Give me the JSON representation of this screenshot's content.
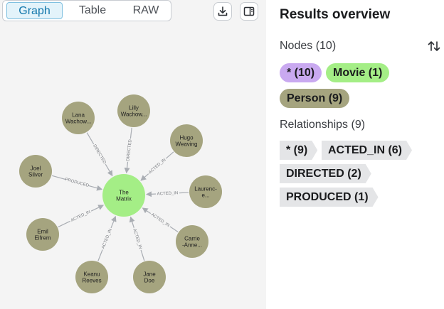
{
  "tabs": [
    {
      "label": "Graph",
      "active": true
    },
    {
      "label": "Table",
      "active": false
    },
    {
      "label": "RAW",
      "active": false
    }
  ],
  "toolbar": {
    "download_icon": "download-icon",
    "panel_icon": "side-panel-icon"
  },
  "graph": {
    "center": {
      "label": "The Matrix",
      "color": "#a4ee86"
    },
    "nodes": [
      {
        "lines": [
          "Lana",
          "Wachow..."
        ],
        "rel": "DIRECTED",
        "color": "#a5a47f"
      },
      {
        "lines": [
          "Lilly",
          "Wachow..."
        ],
        "rel": "DIRECTED",
        "color": "#a5a47f"
      },
      {
        "lines": [
          "Hugo",
          "Weaving"
        ],
        "rel": "ACTED_IN",
        "color": "#a5a47f"
      },
      {
        "lines": [
          "Laurenc-",
          "e..."
        ],
        "rel": "ACTED_IN",
        "color": "#a5a47f"
      },
      {
        "lines": [
          "Carrie",
          "-Anne..."
        ],
        "rel": "ACTED_IN",
        "color": "#a5a47f"
      },
      {
        "lines": [
          "Jane",
          "Doe"
        ],
        "rel": "ACTED_IN",
        "color": "#a5a47f"
      },
      {
        "lines": [
          "Keanu",
          "Reeves"
        ],
        "rel": "ACTED_IN",
        "color": "#a5a47f"
      },
      {
        "lines": [
          "Emil",
          "Eifrem"
        ],
        "rel": "ACTED_IN",
        "color": "#a5a47f"
      },
      {
        "lines": [
          "Joel",
          "Silver"
        ],
        "rel": "PRODUCED",
        "color": "#a5a47f"
      }
    ]
  },
  "overview": {
    "title": "Results overview",
    "nodes_heading": "Nodes (10)",
    "node_labels": [
      {
        "label": "* (10)",
        "color": "#c9a9f0"
      },
      {
        "label": "Movie (1)",
        "color": "#a4ee86"
      },
      {
        "label": "Person (9)",
        "color": "#a5a47f"
      }
    ],
    "rels_heading": "Relationships (9)",
    "rel_types": [
      {
        "label": "* (9)"
      },
      {
        "label": "ACTED_IN (6)"
      },
      {
        "label": "DIRECTED (2)"
      },
      {
        "label": "PRODUCED (1)"
      }
    ]
  }
}
